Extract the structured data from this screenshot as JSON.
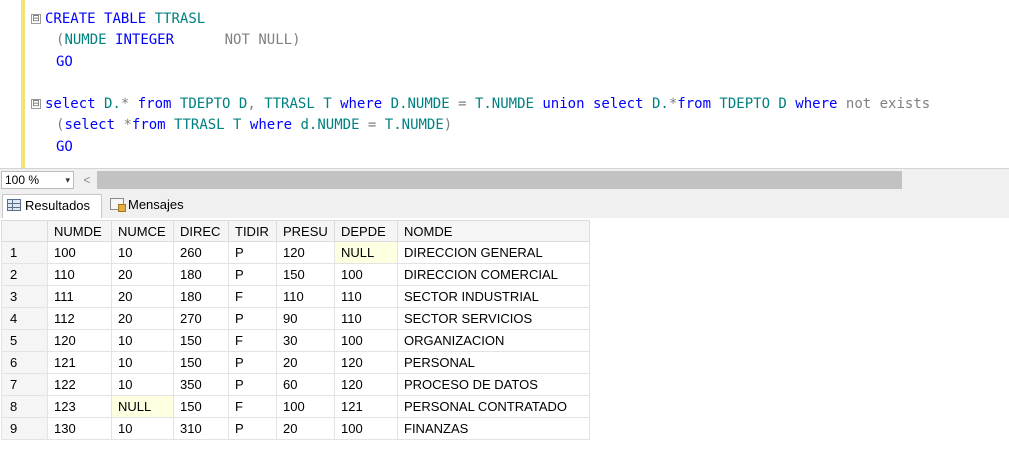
{
  "editor": {
    "lines": [
      [
        {
          "t": "CREATE",
          "c": "kw"
        },
        {
          "t": " ",
          "c": "plain"
        },
        {
          "t": "TABLE",
          "c": "kw"
        },
        {
          "t": " ",
          "c": "plain"
        },
        {
          "t": "TTRASL",
          "c": "tl"
        }
      ],
      [
        {
          "t": "(",
          "c": "gr"
        },
        {
          "t": "NUMDE",
          "c": "tl"
        },
        {
          "t": " ",
          "c": "plain"
        },
        {
          "t": "INTEGER",
          "c": "kw"
        },
        {
          "t": "      ",
          "c": "plain"
        },
        {
          "t": "NOT NULL",
          "c": "gr"
        },
        {
          "t": ")",
          "c": "gr"
        }
      ],
      [
        {
          "t": "GO",
          "c": "kw"
        }
      ],
      [],
      [
        {
          "t": "select",
          "c": "kw"
        },
        {
          "t": " D.",
          "c": "tl"
        },
        {
          "t": "*",
          "c": "gr"
        },
        {
          "t": " ",
          "c": "plain"
        },
        {
          "t": "from",
          "c": "kw"
        },
        {
          "t": " TDEPTO D",
          "c": "tl"
        },
        {
          "t": ",",
          "c": "gr"
        },
        {
          "t": " TTRASL T ",
          "c": "tl"
        },
        {
          "t": "where",
          "c": "kw"
        },
        {
          "t": " D.NUMDE ",
          "c": "tl"
        },
        {
          "t": "=",
          "c": "gr"
        },
        {
          "t": " T.NUMDE ",
          "c": "tl"
        },
        {
          "t": "union",
          "c": "kw"
        },
        {
          "t": " ",
          "c": "plain"
        },
        {
          "t": "select",
          "c": "kw"
        },
        {
          "t": " D.",
          "c": "tl"
        },
        {
          "t": "*",
          "c": "gr"
        },
        {
          "t": "from",
          "c": "kw"
        },
        {
          "t": " TDEPTO D ",
          "c": "tl"
        },
        {
          "t": "where",
          "c": "kw"
        },
        {
          "t": " ",
          "c": "plain"
        },
        {
          "t": "not exists",
          "c": "gr"
        }
      ],
      [
        {
          "t": "(",
          "c": "gr"
        },
        {
          "t": "select",
          "c": "kw"
        },
        {
          "t": " ",
          "c": "plain"
        },
        {
          "t": "*",
          "c": "gr"
        },
        {
          "t": "from",
          "c": "kw"
        },
        {
          "t": " TTRASL T ",
          "c": "tl"
        },
        {
          "t": "where",
          "c": "kw"
        },
        {
          "t": " d.NUMDE ",
          "c": "tl"
        },
        {
          "t": "=",
          "c": "gr"
        },
        {
          "t": " T.NUMDE",
          "c": "tl"
        },
        {
          "t": ")",
          "c": "gr"
        }
      ],
      [
        {
          "t": "GO",
          "c": "kw"
        }
      ]
    ],
    "fold_marker": "⊟"
  },
  "zoom": {
    "value": "100 %",
    "dropdown_glyph": "▾",
    "scroll_left_glyph": "<"
  },
  "tabs": {
    "results_label": "Resultados",
    "messages_label": "Mensajes"
  },
  "grid": {
    "columns": [
      "NUMDE",
      "NUMCE",
      "DIREC",
      "TIDIR",
      "PRESU",
      "DEPDE",
      "NOMDE"
    ],
    "rows": [
      [
        "1",
        "100",
        "10",
        "260",
        "P",
        "120",
        "NULL",
        "DIRECCION GENERAL"
      ],
      [
        "2",
        "110",
        "20",
        "180",
        "P",
        "150",
        "100",
        "DIRECCION COMERCIAL"
      ],
      [
        "3",
        "111",
        "20",
        "180",
        "F",
        "110",
        "110",
        "SECTOR INDUSTRIAL"
      ],
      [
        "4",
        "112",
        "20",
        "270",
        "P",
        "90",
        "110",
        "SECTOR SERVICIOS"
      ],
      [
        "5",
        "120",
        "10",
        "150",
        "F",
        "30",
        "100",
        "ORGANIZACION"
      ],
      [
        "6",
        "121",
        "10",
        "150",
        "P",
        "20",
        "120",
        "PERSONAL"
      ],
      [
        "7",
        "122",
        "10",
        "350",
        "P",
        "60",
        "120",
        "PROCESO DE DATOS"
      ],
      [
        "8",
        "123",
        "NULL",
        "150",
        "F",
        "100",
        "121",
        "PERSONAL CONTRATADO"
      ],
      [
        "9",
        "130",
        "10",
        "310",
        "P",
        "20",
        "100",
        "FINANZAS"
      ]
    ],
    "null_text": "NULL"
  }
}
